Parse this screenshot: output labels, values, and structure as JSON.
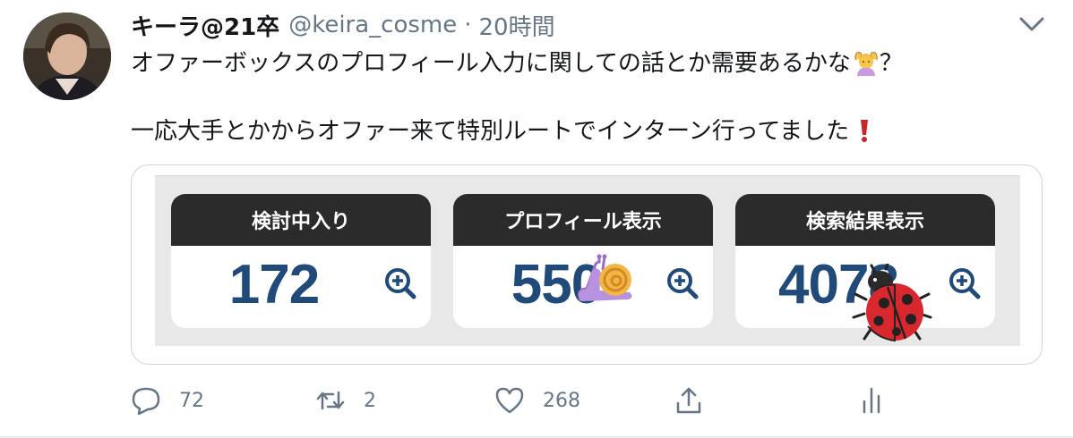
{
  "tweet": {
    "display_name": "キーラ@21卒",
    "handle": "@keira_cosme",
    "separator": "·",
    "time": "20時間",
    "lines": [
      "オファーボックスのプロフィール入力に関しての話とか需要あるかな",
      "一応大手とかからオファー来て特別ルートでインターン行ってました"
    ],
    "line1_suffix": "？"
  },
  "media": {
    "cards": [
      {
        "title": "検討中入り",
        "value": "172"
      },
      {
        "title": "プロフィール表示",
        "value": "550"
      },
      {
        "title": "検索結果表示",
        "value": "4078"
      }
    ],
    "stickers": [
      "snail-sticker",
      "ladybug-sticker"
    ]
  },
  "actions": {
    "reply_count": "72",
    "retweet_count": "2",
    "like_count": "268"
  },
  "icons": {
    "reply": "reply-icon",
    "retweet": "retweet-icon",
    "like": "heart-icon",
    "share": "share-icon",
    "analytics": "analytics-icon",
    "caret": "chevron-down-icon"
  },
  "colors": {
    "text": "#14171a",
    "muted": "#657786",
    "card_header": "#2b2b2b",
    "stat_number": "#1f4a7a",
    "border": "#ccd6dd"
  }
}
